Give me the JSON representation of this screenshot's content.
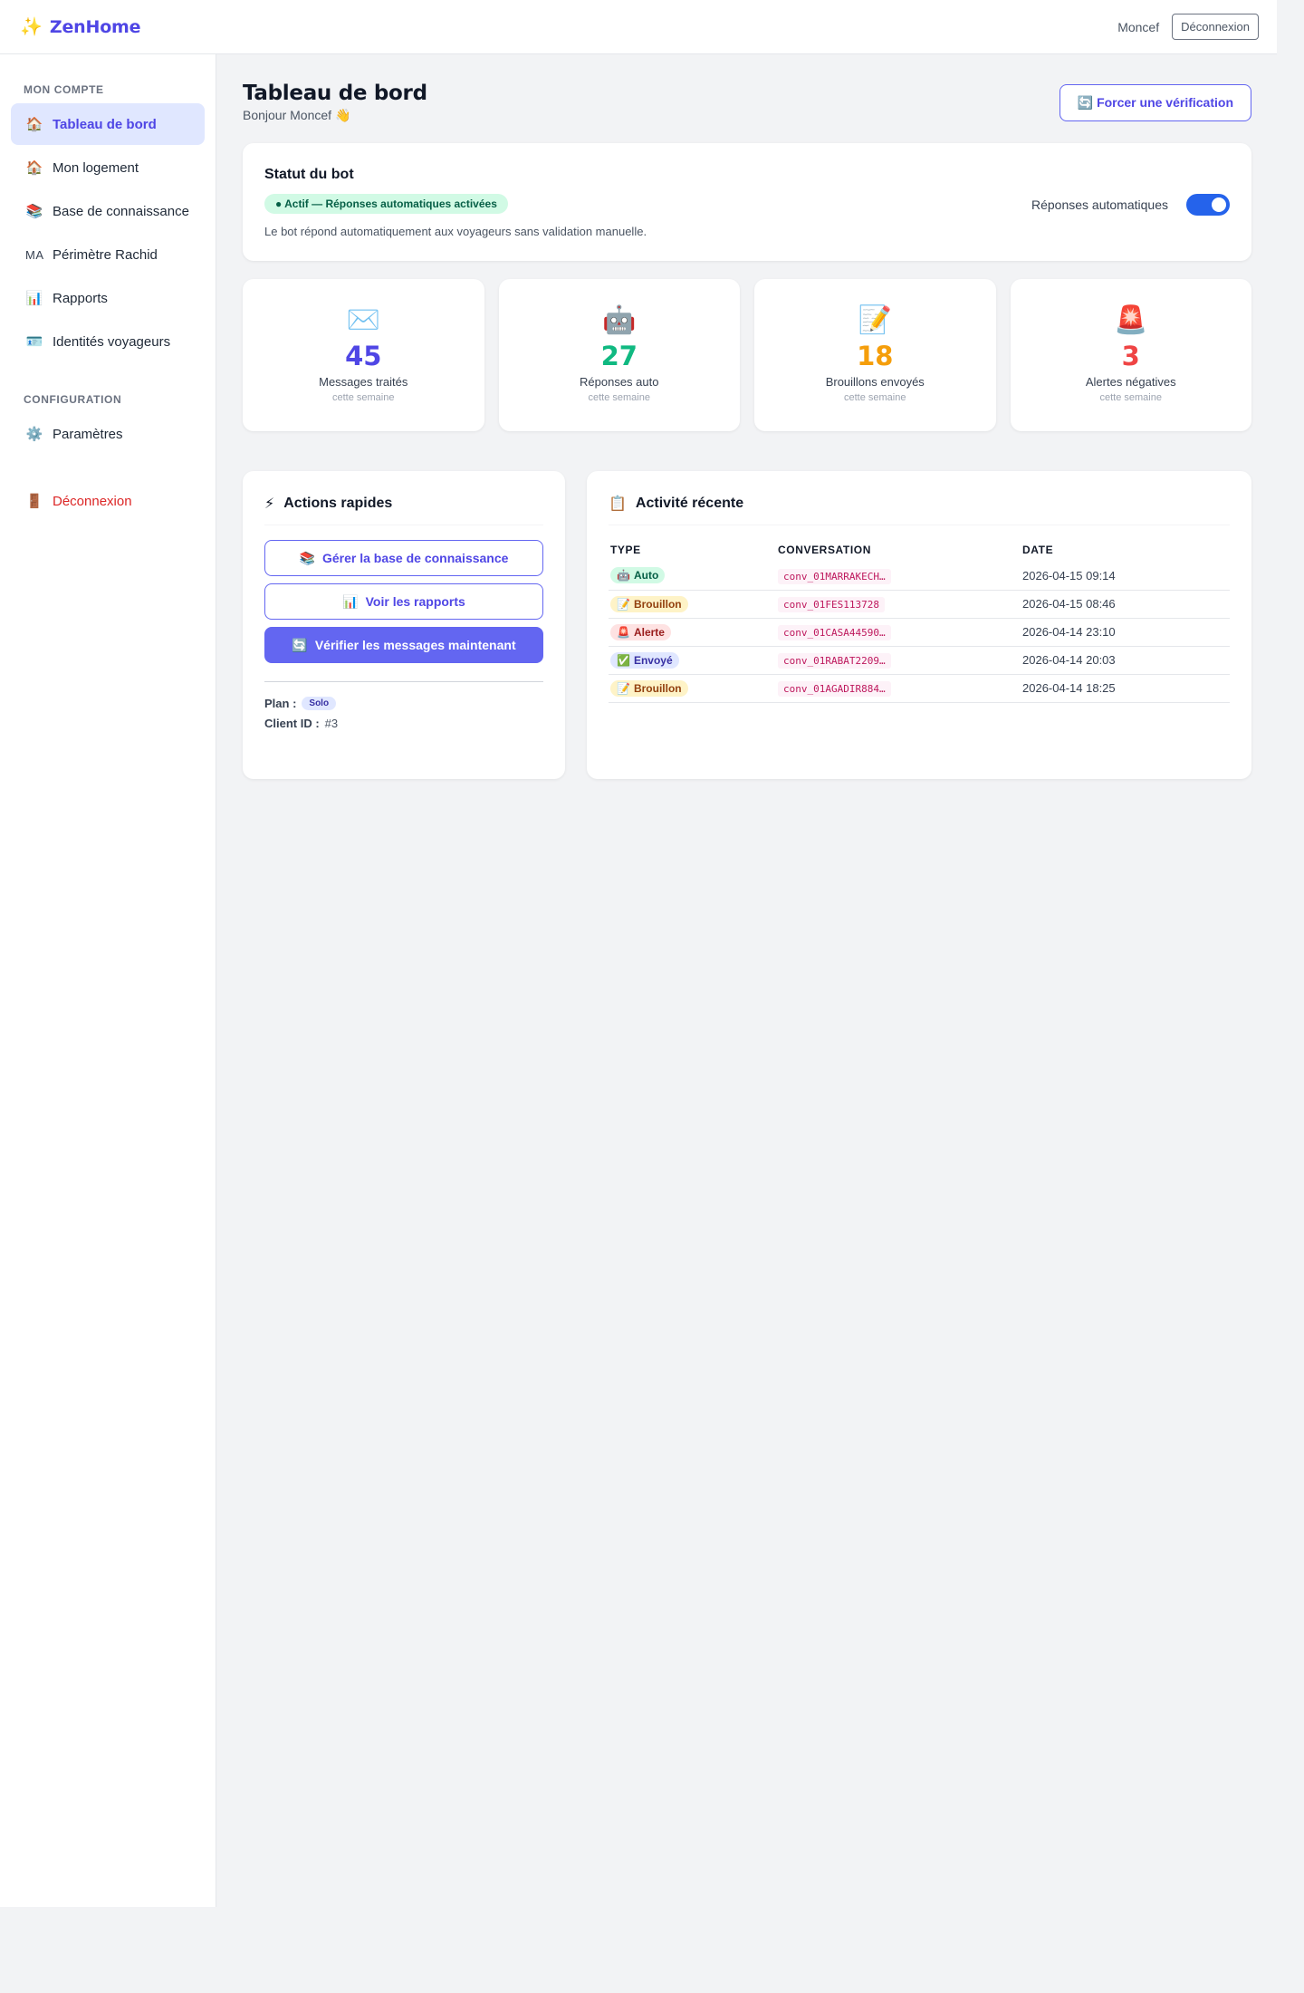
{
  "topbar": {
    "brand_icon": "sparkle-icon",
    "brand_name": "ZenHome",
    "user_name": "Moncef",
    "logout_label": "Déconnexion"
  },
  "sidebar": {
    "section_account": "MON COMPTE",
    "section_config": "CONFIGURATION",
    "items": [
      {
        "icon": "🏠",
        "label": "Tableau de bord",
        "active": true
      },
      {
        "icon": "🏠",
        "label": "Mon logement"
      },
      {
        "icon": "📚",
        "label": "Base de connaissance"
      },
      {
        "icon": "MA",
        "label": "Périmètre Rachid"
      },
      {
        "icon": "📊",
        "label": "Rapports"
      },
      {
        "icon": "🪪",
        "label": "Identités voyageurs"
      },
      {
        "icon": "⚙️",
        "label": "Paramètres"
      },
      {
        "icon": "🚪",
        "label": "Déconnexion"
      }
    ]
  },
  "header": {
    "title": "Tableau de bord",
    "subtitle": "Bonjour Moncef 👋",
    "force_icon": "🔄",
    "force_label": "Forcer une vérification"
  },
  "bot_status": {
    "title": "Statut du bot",
    "status_pill": "● Actif — Réponses automatiques activées",
    "description": "Le bot répond automatiquement aux voyageurs sans validation manuelle.",
    "toggle_label": "Réponses automatiques",
    "toggle_on": true
  },
  "stats": [
    {
      "icon": "✉️",
      "value": "45",
      "label": "Messages traités",
      "sub": "cette semaine",
      "color": "#4f46e5"
    },
    {
      "icon": "🤖",
      "value": "27",
      "label": "Réponses auto",
      "sub": "cette semaine",
      "color": "#10b981"
    },
    {
      "icon": "📝",
      "value": "18",
      "label": "Brouillons envoyés",
      "sub": "cette semaine",
      "color": "#f59e0b"
    },
    {
      "icon": "🚨",
      "value": "3",
      "label": "Alertes négatives",
      "sub": "cette semaine",
      "color": "#ef4444"
    }
  ],
  "quick_actions": {
    "icon": "⚡",
    "title": "Actions rapides",
    "btn_kb_icon": "📚",
    "btn_kb": "Gérer la base de connaissance",
    "btn_reports_icon": "📊",
    "btn_reports": "Voir les rapports",
    "btn_check_icon": "🔄",
    "btn_check": "Vérifier les messages maintenant",
    "plan_label": "Plan :",
    "plan_value": "Solo",
    "client_label": "Client ID :",
    "client_value": "#3"
  },
  "activity": {
    "icon": "📋",
    "title": "Activité récente",
    "columns": [
      "TYPE",
      "CONVERSATION",
      "DATE"
    ],
    "rows": [
      {
        "type_icon": "🤖",
        "type": "Auto",
        "kind": "auto",
        "conversation": "conv_01MARRAKECH…",
        "date": "2026-04-15 09:14"
      },
      {
        "type_icon": "📝",
        "type": "Brouillon",
        "kind": "draft",
        "conversation": "conv_01FES113728",
        "date": "2026-04-15 08:46"
      },
      {
        "type_icon": "🚨",
        "type": "Alerte",
        "kind": "alert",
        "conversation": "conv_01CASA44590…",
        "date": "2026-04-14 23:10"
      },
      {
        "type_icon": "✅",
        "type": "Envoyé",
        "kind": "sent",
        "conversation": "conv_01RABAT2209…",
        "date": "2026-04-14 20:03"
      },
      {
        "type_icon": "📝",
        "type": "Brouillon",
        "kind": "draft",
        "conversation": "conv_01AGADIR884…",
        "date": "2026-04-14 18:25"
      }
    ]
  }
}
